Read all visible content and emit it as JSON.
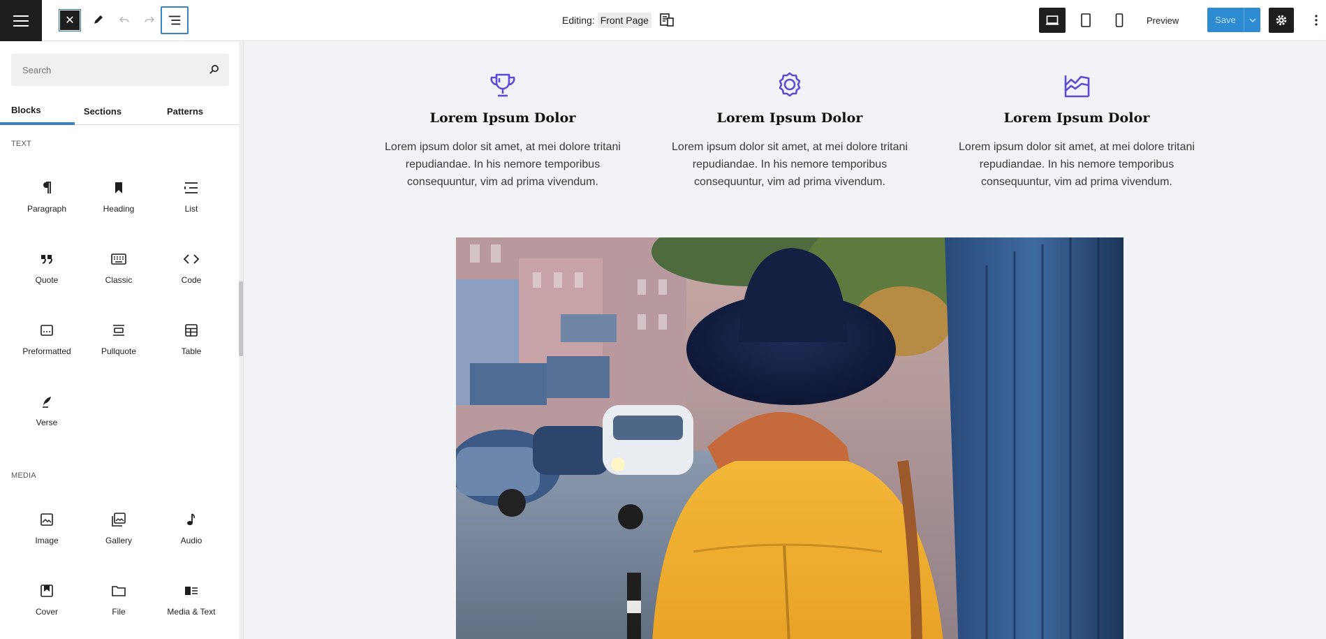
{
  "topbar": {
    "editing_label": "Editing:",
    "document_title": "Front Page",
    "preview_label": "Preview",
    "save_label": "Save"
  },
  "sidebar": {
    "search_placeholder": "Search",
    "tabs": [
      "Blocks",
      "Sections",
      "Patterns"
    ],
    "categories": [
      {
        "name": "TEXT",
        "blocks": [
          {
            "label": "Paragraph",
            "icon": "paragraph-icon"
          },
          {
            "label": "Heading",
            "icon": "heading-icon"
          },
          {
            "label": "List",
            "icon": "list-icon"
          },
          {
            "label": "Quote",
            "icon": "quote-icon"
          },
          {
            "label": "Classic",
            "icon": "classic-icon"
          },
          {
            "label": "Code",
            "icon": "code-icon"
          },
          {
            "label": "Preformatted",
            "icon": "preformatted-icon"
          },
          {
            "label": "Pullquote",
            "icon": "pullquote-icon"
          },
          {
            "label": "Table",
            "icon": "table-icon"
          },
          {
            "label": "Verse",
            "icon": "verse-icon"
          }
        ]
      },
      {
        "name": "MEDIA",
        "blocks": [
          {
            "label": "Image",
            "icon": "image-icon"
          },
          {
            "label": "Gallery",
            "icon": "gallery-icon"
          },
          {
            "label": "Audio",
            "icon": "audio-icon"
          },
          {
            "label": "Cover",
            "icon": "cover-icon"
          },
          {
            "label": "File",
            "icon": "file-icon"
          },
          {
            "label": "Media & Text",
            "icon": "media-text-icon"
          }
        ]
      }
    ]
  },
  "canvas": {
    "features": [
      {
        "icon": "trophy-icon",
        "title": "Lorem Ipsum Dolor",
        "text": "Lorem ipsum dolor sit amet, at mei dolore tritani repudiandae. In his nemore temporibus consequuntur, vim ad prima vivendum."
      },
      {
        "icon": "award-ribbon-icon",
        "title": "Lorem Ipsum Dolor",
        "text": "Lorem ipsum dolor sit amet, at mei dolore tritani repudiandae. In his nemore temporibus consequuntur, vim ad prima vivendum."
      },
      {
        "icon": "area-chart-icon",
        "title": "Lorem Ipsum Dolor",
        "text": "Lorem ipsum dolor sit amet, at mei dolore tritani repudiandae. In his nemore temporibus consequuntur, vim ad prima vivendum."
      }
    ],
    "photo": {
      "icon": "photo-woman-hat-street"
    }
  },
  "colors": {
    "accent": "#3582c4",
    "save": "#2c8bd1",
    "icon_purple": "#5b4bd5",
    "canvas_bg": "#f2f3f7"
  }
}
